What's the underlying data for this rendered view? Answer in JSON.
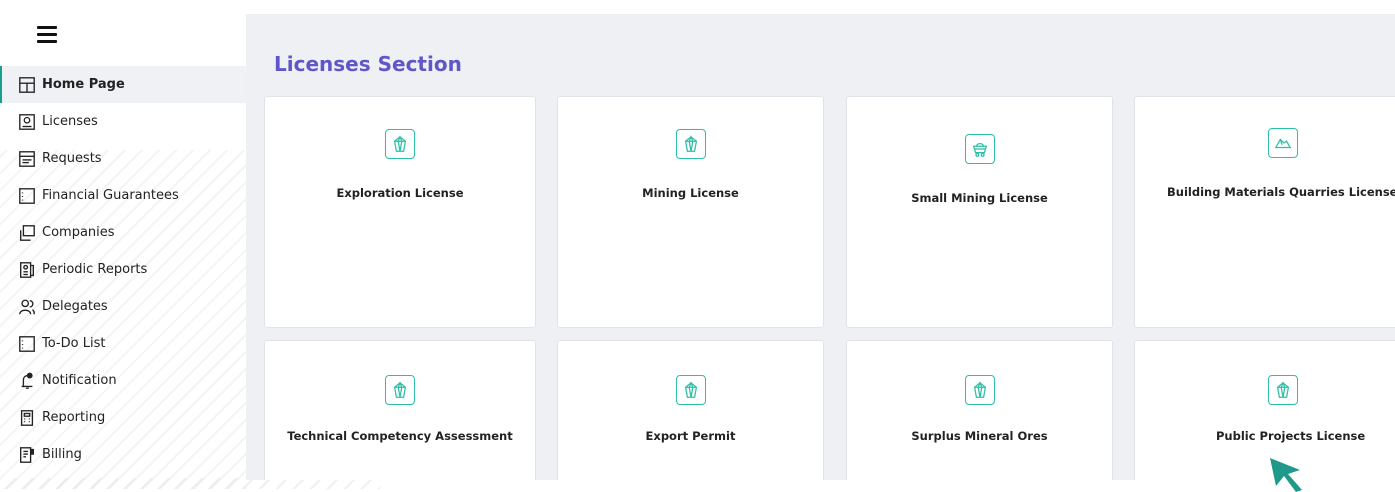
{
  "sidebar": {
    "items": [
      {
        "label": "Home Page",
        "icon": "layout-icon",
        "active": true
      },
      {
        "label": "Licenses",
        "icon": "id-card-icon"
      },
      {
        "label": "Requests",
        "icon": "list-box-icon"
      },
      {
        "label": "Financial Guarantees",
        "icon": "dotted-box-icon"
      },
      {
        "label": "Companies",
        "icon": "copy-icon"
      },
      {
        "label": "Periodic Reports",
        "icon": "report-doc-icon"
      },
      {
        "label": "Delegates",
        "icon": "users-icon"
      },
      {
        "label": "To-Do List",
        "icon": "dotted-box-icon"
      },
      {
        "label": "Notification",
        "icon": "bell-icon"
      },
      {
        "label": "Reporting",
        "icon": "calculator-icon"
      },
      {
        "label": "Billing",
        "icon": "invoice-icon"
      }
    ]
  },
  "main": {
    "title": "Licenses Section",
    "cards": [
      {
        "label": "Exploration License",
        "icon": "crystal-icon"
      },
      {
        "label": "Mining License",
        "icon": "crystal-icon"
      },
      {
        "label": "Small Mining License",
        "icon": "mine-cart-icon"
      },
      {
        "label": "Building Materials Quarries Licenses",
        "icon": "rocks-icon"
      },
      {
        "label": "Technical Competency Assessment",
        "icon": "crystal-icon"
      },
      {
        "label": "Export Permit",
        "icon": "crystal-icon"
      },
      {
        "label": "Surplus Mineral Ores",
        "icon": "crystal-icon"
      },
      {
        "label": "Public Projects License",
        "icon": "crystal-icon"
      }
    ]
  },
  "colors": {
    "accent": "#2fbfa7",
    "title": "#5f57c9",
    "background": "#eef0f4",
    "cursor": "#1f9a8a"
  }
}
